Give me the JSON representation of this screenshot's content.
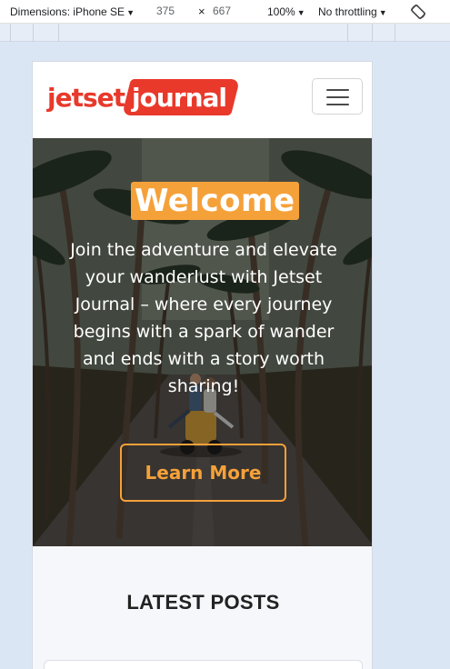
{
  "devtools": {
    "dimensions_label": "Dimensions: iPhone SE",
    "width": "375",
    "times": "×",
    "height": "667",
    "zoom": "100%",
    "throttle": "No throttling",
    "rotate_icon": "rotate-icon"
  },
  "navbar": {
    "logo_part1": "jetset",
    "logo_part2": "journal",
    "menu_icon": "hamburger-icon"
  },
  "hero": {
    "title": "Welcome",
    "text": "Join the adventure and elevate your wanderlust with Jetset Journal – where every journey begins with a spark of wander and ends with a story worth sharing!",
    "button_label": "Learn More"
  },
  "latest": {
    "heading": "LATEST POSTS"
  },
  "colors": {
    "brand_red": "#e8392b",
    "accent_orange": "#f5a13a"
  }
}
